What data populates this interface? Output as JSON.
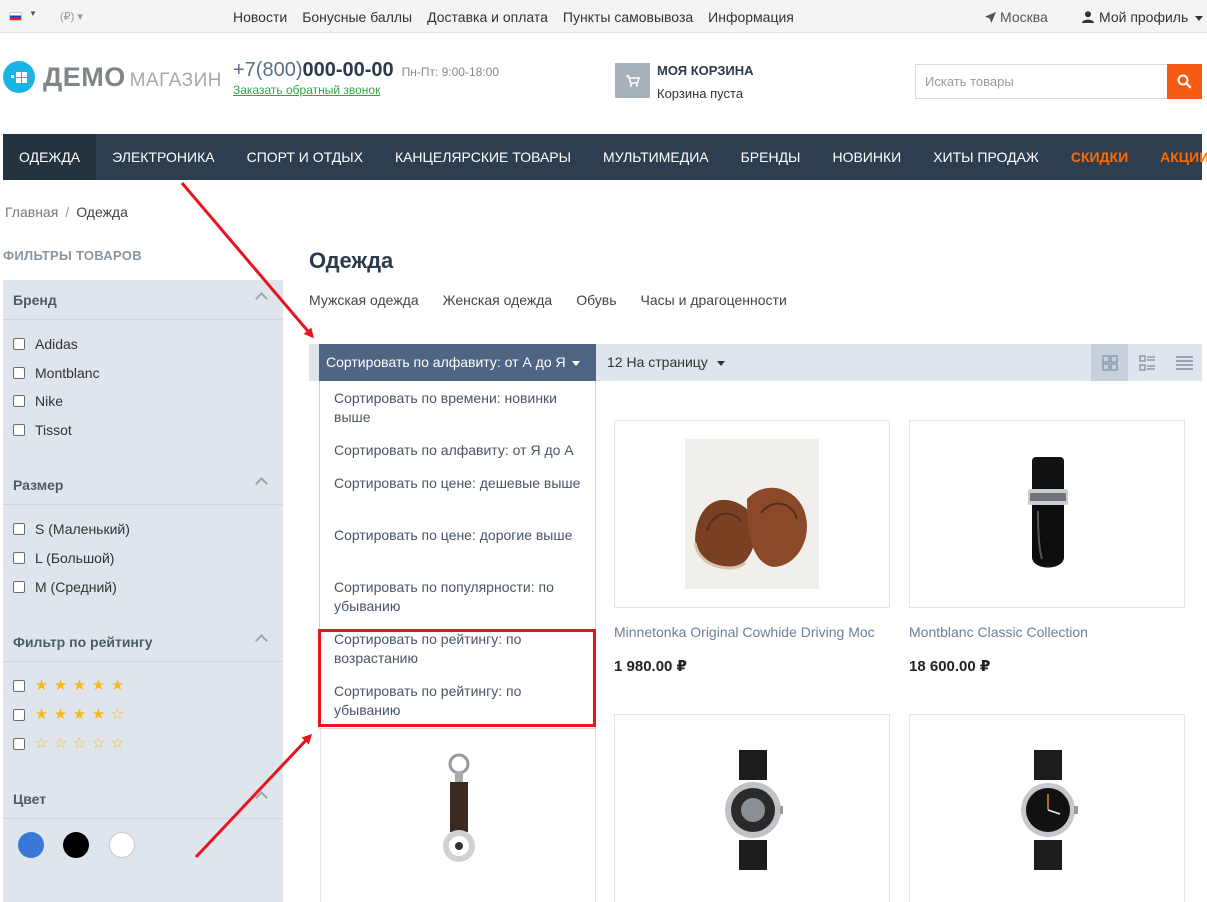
{
  "topbar": {
    "currency": "(₽)",
    "nav": [
      "Новости",
      "Бонусные баллы",
      "Доставка и оплата",
      "Пункты самовывоза",
      "Информация"
    ],
    "city": "Москва",
    "profile": "Мой профиль"
  },
  "header": {
    "logo_main": "ДЕМО",
    "logo_sub": "МАГАЗИН",
    "phone_code": "+7(800)",
    "phone_number": "000-00-00",
    "phone_hours": "Пн-Пт: 9:00-18:00",
    "callback": "Заказать обратный звонок",
    "cart_title": "МОЯ КОРЗИНА",
    "cart_status": "Корзина пуста",
    "search_placeholder": "Искать товары"
  },
  "mainnav": [
    "ОДЕЖДА",
    "ЭЛЕКТРОНИКА",
    "СПОРТ И ОТДЫХ",
    "КАНЦЕЛЯРСКИЕ ТОВАРЫ",
    "МУЛЬТИМЕДИА",
    "БРЕНДЫ",
    "НОВИНКИ",
    "ХИТЫ ПРОДАЖ",
    "СКИДКИ",
    "АКЦИИ"
  ],
  "breadcrumb": {
    "home": "Главная",
    "separator": "/",
    "current": "Одежда"
  },
  "filters": {
    "title": "ФИЛЬТРЫ ТОВАРОВ",
    "brand": {
      "title": "Бренд",
      "options": [
        "Adidas",
        "Montblanc",
        "Nike",
        "Tissot"
      ]
    },
    "size": {
      "title": "Размер",
      "options": [
        "S (Маленький)",
        "L (Большой)",
        "M (Средний)"
      ]
    },
    "rating": {
      "title": "Фильтр по рейтингу",
      "levels": [
        5,
        4,
        0
      ]
    },
    "color": {
      "title": "Цвет",
      "swatches": [
        "#3a78d6",
        "#000000",
        "#ffffff"
      ]
    }
  },
  "content": {
    "title": "Одежда",
    "subcategories": [
      "Мужская одежда",
      "Женская одежда",
      "Обувь",
      "Часы и драгоценности"
    ],
    "sort_selected": "Сортировать по алфавиту: от А до Я",
    "per_page": "12 На страницу",
    "sort_options": [
      "Сортировать по времени: новинки выше",
      "Сортировать по алфавиту: от Я до А",
      "Сортировать по цене: дешевые выше",
      "Сортировать по цене: дорогие выше",
      "Сортировать по популярности: по убыванию",
      "Сортировать по рейтингу: по возрастанию",
      "Сортировать по рейтингу: по убыванию"
    ],
    "products": [
      {
        "name": "Minnetonka Original Cowhide Driving Moc",
        "price": "1 980.00 ₽"
      },
      {
        "name": "Montblanc Classic Collection",
        "price": "18 600.00 ₽"
      }
    ]
  },
  "colors": {
    "accent_orange": "#f75a13",
    "nav_bg": "#2c3e50",
    "sort_bg": "#4e6584",
    "highlight": "#e8141c"
  }
}
